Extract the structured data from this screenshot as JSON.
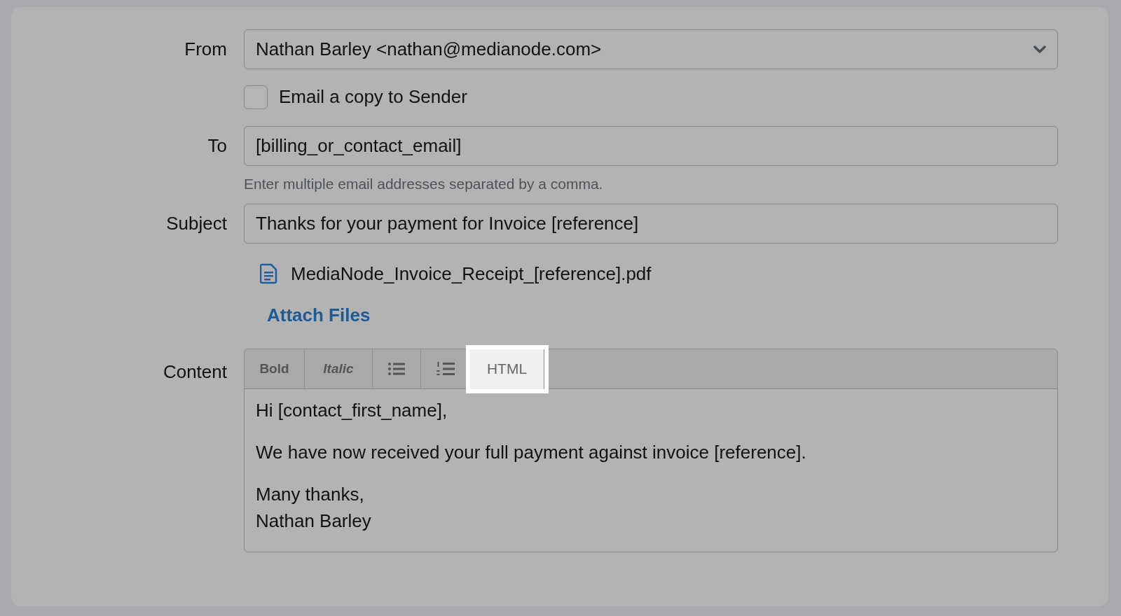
{
  "from": {
    "label": "From",
    "value": "Nathan Barley <nathan@medianode.com>"
  },
  "copy_to_sender": {
    "label": "Email a copy to Sender",
    "checked": false
  },
  "to": {
    "label": "To",
    "value": "[billing_or_contact_email]",
    "hint": "Enter multiple email addresses separated by a comma."
  },
  "subject": {
    "label": "Subject",
    "value": "Thanks for your payment for Invoice [reference]"
  },
  "attachment": {
    "filename": "MediaNode_Invoice_Receipt_[reference].pdf"
  },
  "attach_link": "Attach Files",
  "content": {
    "label": "Content",
    "toolbar": [
      {
        "kind": "bold",
        "label": "Bold",
        "selected": false
      },
      {
        "kind": "italic",
        "label": "Italic",
        "selected": false
      },
      {
        "kind": "bullets",
        "selected": false
      },
      {
        "kind": "numbers",
        "selected": false
      },
      {
        "kind": "text",
        "label": "HTML",
        "selected": true
      }
    ],
    "paragraphs": [
      [
        "Hi [contact_first_name],"
      ],
      [
        "We have now received your full payment against invoice [reference]."
      ],
      [
        "Many thanks,",
        "Nathan Barley"
      ]
    ]
  }
}
